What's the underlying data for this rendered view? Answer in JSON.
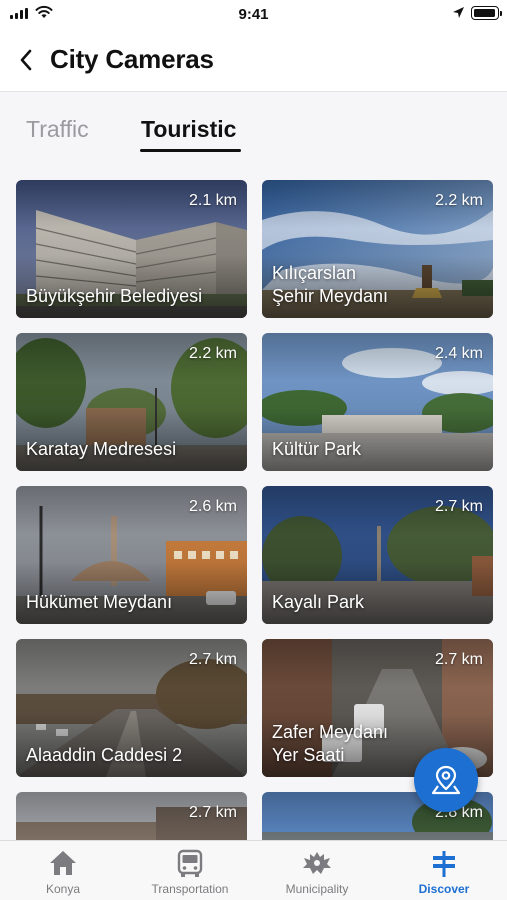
{
  "status": {
    "time": "9:41"
  },
  "header": {
    "title": "City Cameras"
  },
  "tabs": [
    {
      "label": "Traffic",
      "selected": false
    },
    {
      "label": "Touristic",
      "selected": true
    }
  ],
  "cameras": [
    {
      "name": "Büyükşehir Belediyesi",
      "distance": "2.1 km"
    },
    {
      "name": "Kılıçarslan\nŞehir Meydanı",
      "distance": "2.2 km"
    },
    {
      "name": "Karatay Medresesi",
      "distance": "2.2 km"
    },
    {
      "name": "Kültür Park",
      "distance": "2.4 km"
    },
    {
      "name": "Hükümet Meydanı",
      "distance": "2.6 km"
    },
    {
      "name": "Kayalı Park",
      "distance": "2.7 km"
    },
    {
      "name": "Alaaddin Caddesi 2",
      "distance": "2.7 km"
    },
    {
      "name": "Zafer Meydanı\nYer Saati",
      "distance": "2.7 km"
    },
    {
      "name": "",
      "distance": "2.7 km"
    },
    {
      "name": "",
      "distance": "2.8 km"
    }
  ],
  "fab": {
    "icon": "map-pin-icon"
  },
  "tab_bar": {
    "items": [
      {
        "label": "Konya",
        "icon": "home-icon",
        "active": false
      },
      {
        "label": "Transportation",
        "icon": "bus-icon",
        "active": false
      },
      {
        "label": "Municipality",
        "icon": "emblem-icon",
        "active": false
      },
      {
        "label": "Discover",
        "icon": "signpost-icon",
        "active": true
      }
    ]
  },
  "colors": {
    "accent": "#1d6fd1",
    "inactive": "#7c7c80"
  }
}
